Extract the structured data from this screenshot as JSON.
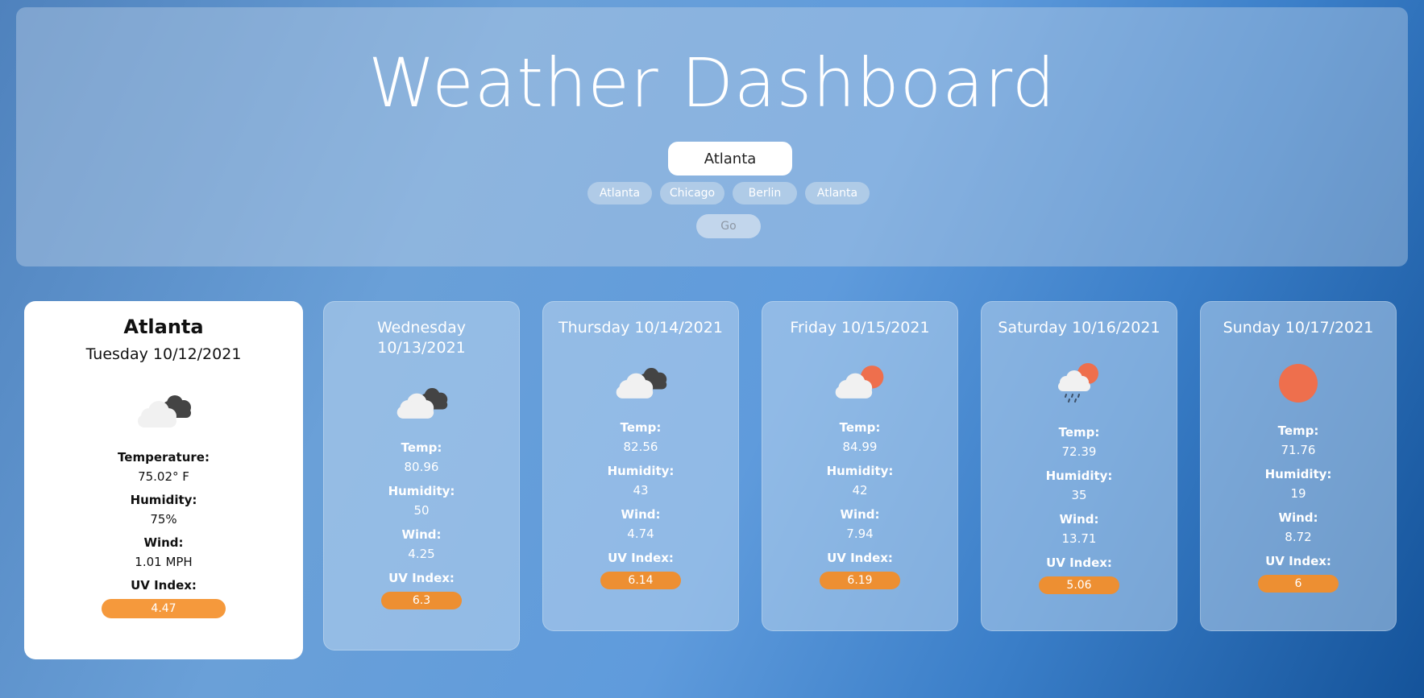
{
  "header": {
    "title": "Weather Dashboard"
  },
  "search": {
    "value": "Atlanta"
  },
  "history": [
    "Atlanta",
    "Chicago",
    "Berlin",
    "Atlanta"
  ],
  "go_label": "Go",
  "current": {
    "city": "Atlanta",
    "date": "Tuesday 10/12/2021",
    "icon": "partly-cloudy-dark-icon",
    "temp_label": "Temperature:",
    "temp": "75.02° F",
    "humidity_label": "Humidity:",
    "humidity": "75%",
    "wind_label": "Wind:",
    "wind": "1.01 MPH",
    "uv_label": "UV Index:",
    "uv": "4.47"
  },
  "forecast": [
    {
      "day": "Wednesday 10/13/2021",
      "icon": "cloudy-dark-icon",
      "temp_label": "Temp:",
      "temp": "80.96",
      "humidity_label": "Humidity:",
      "humidity": "50",
      "wind_label": "Wind:",
      "wind": "4.25",
      "uv_label": "UV Index:",
      "uv": "6.3"
    },
    {
      "day": "Thursday 10/14/2021",
      "icon": "cloudy-dark-icon",
      "temp_label": "Temp:",
      "temp": "82.56",
      "humidity_label": "Humidity:",
      "humidity": "43",
      "wind_label": "Wind:",
      "wind": "4.74",
      "uv_label": "UV Index:",
      "uv": "6.14"
    },
    {
      "day": "Friday 10/15/2021",
      "icon": "partly-sunny-icon",
      "temp_label": "Temp:",
      "temp": "84.99",
      "humidity_label": "Humidity:",
      "humidity": "42",
      "wind_label": "Wind:",
      "wind": "7.94",
      "uv_label": "UV Index:",
      "uv": "6.19"
    },
    {
      "day": "Saturday 10/16/2021",
      "icon": "sun-rain-icon",
      "temp_label": "Temp:",
      "temp": "72.39",
      "humidity_label": "Humidity:",
      "humidity": "35",
      "wind_label": "Wind:",
      "wind": "13.71",
      "uv_label": "UV Index:",
      "uv": "5.06"
    },
    {
      "day": "Sunday 10/17/2021",
      "icon": "sun-icon",
      "temp_label": "Temp:",
      "temp": "71.76",
      "humidity_label": "Humidity:",
      "humidity": "19",
      "wind_label": "Wind:",
      "wind": "8.72",
      "uv_label": "UV Index:",
      "uv": "6"
    }
  ],
  "colors": {
    "uv_badge": "#f0933a",
    "sun": "#ee6f4d",
    "cloud_light": "#f1f1f1",
    "cloud_dark": "#444444"
  }
}
